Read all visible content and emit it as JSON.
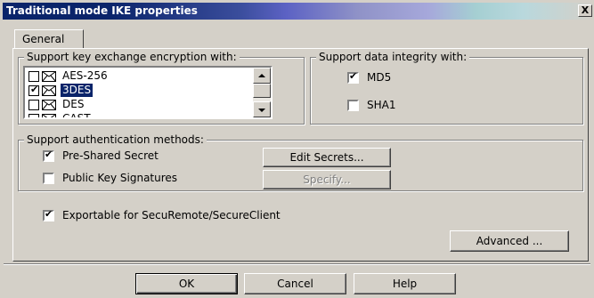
{
  "window": {
    "title": "Traditional mode IKE properties",
    "close_label": "X"
  },
  "tabs": [
    {
      "label": "General"
    }
  ],
  "encryption": {
    "legend": "Support key exchange encryption with:",
    "items": [
      {
        "label": "AES-256",
        "checked": false,
        "selected": false
      },
      {
        "label": "3DES",
        "checked": true,
        "selected": true
      },
      {
        "label": "DES",
        "checked": false,
        "selected": false
      },
      {
        "label": "CAST",
        "checked": false,
        "selected": false
      }
    ]
  },
  "integrity": {
    "legend": "Support data integrity with:",
    "md5": {
      "label": "MD5",
      "checked": true
    },
    "sha1": {
      "label": "SHA1",
      "checked": false
    }
  },
  "authentication": {
    "legend": "Support authentication methods:",
    "preshared": {
      "label": "Pre-Shared Secret",
      "checked": true
    },
    "pubkey": {
      "label": "Public Key Signatures",
      "checked": false
    },
    "edit_secrets_label": "Edit Secrets...",
    "specify_label": "Specify..."
  },
  "exportable": {
    "label": "Exportable for SecuRemote/SecureClient",
    "checked": true
  },
  "advanced_label": "Advanced ...",
  "footer": {
    "ok": "OK",
    "cancel": "Cancel",
    "help": "Help"
  },
  "tick": "✔"
}
